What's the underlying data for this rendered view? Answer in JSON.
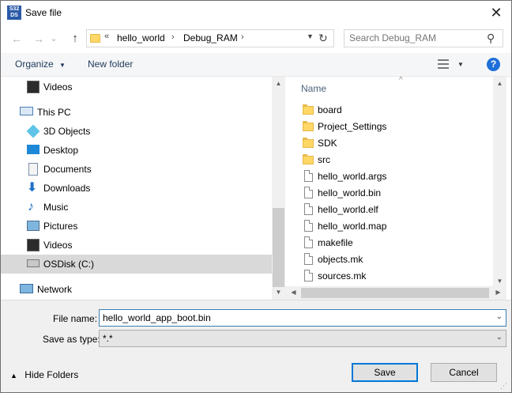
{
  "window": {
    "title": "Save file",
    "app_icon_text": [
      "S32",
      "DS"
    ],
    "close_glyph": "✕"
  },
  "nav": {
    "back_glyph": "←",
    "forward_glyph": "→",
    "recent_glyph": "⌄",
    "up_glyph": "↑",
    "address": {
      "overflow": "«",
      "crumbs": [
        "hello_world",
        "Debug_RAM"
      ],
      "separator": "›"
    },
    "search_placeholder": "Search Debug_RAM"
  },
  "toolbar": {
    "organize_label": "Organize",
    "organize_arrow": "▼",
    "new_folder_label": "New folder",
    "view_arrow": "▼",
    "help_label": "?"
  },
  "nav_pane": {
    "items": [
      {
        "label": "Videos",
        "icon": "videos-icon"
      },
      {
        "label": "This PC",
        "icon": "computer-icon"
      },
      {
        "label": "3D Objects",
        "icon": "3d-objects-icon"
      },
      {
        "label": "Desktop",
        "icon": "desktop-icon"
      },
      {
        "label": "Documents",
        "icon": "documents-icon"
      },
      {
        "label": "Downloads",
        "icon": "downloads-icon"
      },
      {
        "label": "Music",
        "icon": "music-icon"
      },
      {
        "label": "Pictures",
        "icon": "pictures-icon"
      },
      {
        "label": "Videos",
        "icon": "videos-icon"
      },
      {
        "label": "OSDisk (C:)",
        "icon": "drive-icon"
      },
      {
        "label": "Network",
        "icon": "network-icon"
      }
    ]
  },
  "file_pane": {
    "column_name": "Name",
    "sort_glyph": "^",
    "items": [
      {
        "name": "board",
        "type": "folder"
      },
      {
        "name": "Project_Settings",
        "type": "folder"
      },
      {
        "name": "SDK",
        "type": "folder"
      },
      {
        "name": "src",
        "type": "folder"
      },
      {
        "name": "hello_world.args",
        "type": "file"
      },
      {
        "name": "hello_world.bin",
        "type": "file"
      },
      {
        "name": "hello_world.elf",
        "type": "file"
      },
      {
        "name": "hello_world.map",
        "type": "file"
      },
      {
        "name": "makefile",
        "type": "file"
      },
      {
        "name": "objects.mk",
        "type": "file"
      },
      {
        "name": "sources.mk",
        "type": "file"
      }
    ]
  },
  "scroll": {
    "up": "▲",
    "down": "▼",
    "left": "◀",
    "right": "▶"
  },
  "form": {
    "file_name_label": "File name:",
    "file_name_value": "hello_world_app_boot.bin",
    "save_as_type_label": "Save as type:",
    "save_as_type_value": "*.*",
    "dropdown_glyph": "⌄"
  },
  "footer": {
    "hide_folders_glyph": "▲",
    "hide_folders_label": "Hide Folders",
    "save_label": "Save",
    "cancel_label": "Cancel",
    "grip_glyph": "⋰"
  }
}
